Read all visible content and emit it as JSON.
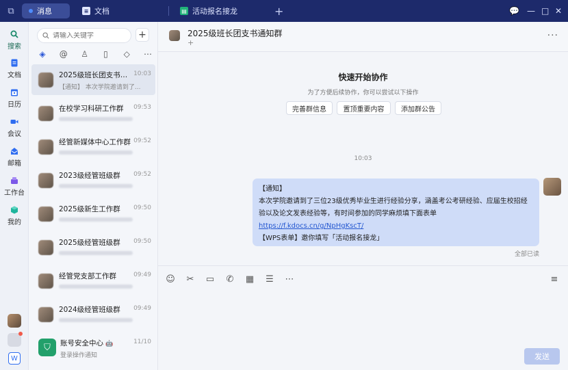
{
  "titlebar": {
    "tabs": [
      {
        "label": "消息"
      },
      {
        "label": "文档"
      },
      {
        "label": "活动报名接龙"
      }
    ],
    "plus_label": "+",
    "controls": [
      "⋯",
      "—",
      "□",
      "✕"
    ]
  },
  "nav": {
    "items": [
      {
        "label": "搜索"
      },
      {
        "label": "文档"
      },
      {
        "label": "日历"
      },
      {
        "label": "会议"
      },
      {
        "label": "邮箱"
      },
      {
        "label": "工作台"
      },
      {
        "label": "我的"
      }
    ],
    "wps_label": "W"
  },
  "search": {
    "placeholder": "请输入关键字"
  },
  "chatlist": {
    "items": [
      {
        "name": "2025级班长团支书通...",
        "time": "10:03",
        "preview": "【通知】 本次学院邀请到了..."
      },
      {
        "name": "在校学习科研工作群",
        "time": "09:53"
      },
      {
        "name": "经管新媒体中心工作群",
        "time": "09:52"
      },
      {
        "name": "2023级经管班级群",
        "time": "09:52"
      },
      {
        "name": "2025级新生工作群",
        "time": "09:50"
      },
      {
        "name": "2025级经管班级群",
        "time": "09:50"
      },
      {
        "name": "经管党支部工作群",
        "time": "09:49"
      },
      {
        "name": "2024级经管班级群",
        "time": "09:49"
      },
      {
        "name": "账号安全中心",
        "time": "11/10",
        "preview": "登录操作通知"
      }
    ]
  },
  "chat": {
    "title": "2025级班长团支书通知群",
    "add": "+",
    "quick_title": "快速开始协作",
    "quick_sub": "为了方便后续协作，你可以尝试以下操作",
    "quick_buttons": [
      "完善群信息",
      "置顶重要内容",
      "添加群公告"
    ],
    "time": "10:03",
    "message": {
      "line1": "【通知】",
      "line2": "本次学院邀请到了三位23级优秀毕业生进行经验分享，涵盖考公考研经验、应届生校招经",
      "line3": "验以及论文发表经验等，有时间参加的同学麻烦填下面表单",
      "link": "https://f.kdocs.cn/g/NpHgKscT/",
      "line5": "【WPS表单】邀你填写「活动报名接龙」"
    },
    "read_status": "全部已读",
    "send_label": "发送"
  }
}
